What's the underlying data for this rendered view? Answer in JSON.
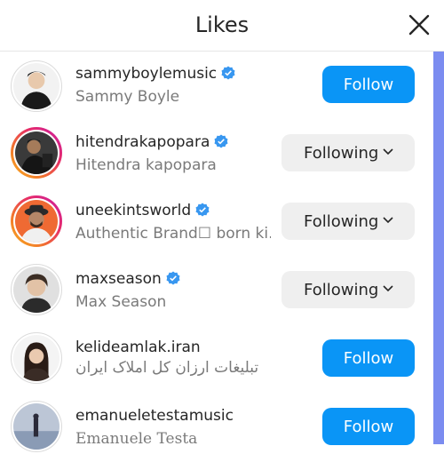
{
  "header": {
    "title": "Likes"
  },
  "colors": {
    "accent": "#0a95f6",
    "verified": "#3897f0",
    "scrollbar": "#7b8cf0"
  },
  "users": [
    {
      "username": "sammyboylemusic",
      "subtitle": "Sammy Boyle",
      "verified": true,
      "button": "Follow",
      "following": false
    },
    {
      "username": "hitendrakapopara",
      "subtitle": "Hitendra kapopara",
      "verified": true,
      "button": "Following",
      "following": true
    },
    {
      "username": "uneekintsworld",
      "subtitle": "Authentic Brand☐ born ki...",
      "verified": true,
      "button": "Following",
      "following": true
    },
    {
      "username": "maxseason",
      "subtitle": "Max Season",
      "verified": true,
      "button": "Following",
      "following": true
    },
    {
      "username": "kelideamlak.iran",
      "subtitle": "تبلیغات ارزان کل املاک ایران",
      "verified": false,
      "button": "Follow",
      "following": false
    },
    {
      "username": "emanueletestamusic",
      "subtitle": "Emanuele Testa",
      "verified": false,
      "button": "Follow",
      "following": false
    }
  ]
}
